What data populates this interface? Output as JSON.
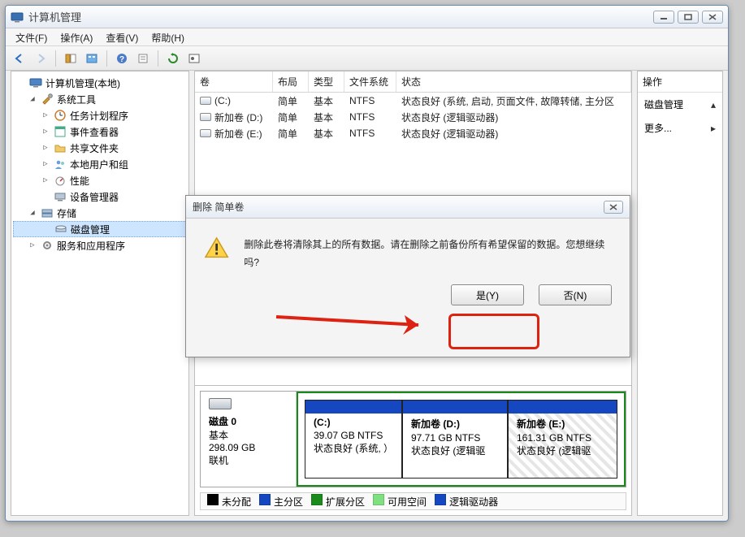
{
  "window": {
    "title": "计算机管理"
  },
  "menu": {
    "file": "文件(F)",
    "action": "操作(A)",
    "view": "查看(V)",
    "help": "帮助(H)"
  },
  "tree": {
    "root": "计算机管理(本地)",
    "systools": "系统工具",
    "sched": "任务计划程序",
    "evt": "事件查看器",
    "share": "共享文件夹",
    "users": "本地用户和组",
    "perf": "性能",
    "devmgr": "设备管理器",
    "storage": "存储",
    "diskmgmt": "磁盘管理",
    "services": "服务和应用程序"
  },
  "volumes": {
    "headers": {
      "vol": "卷",
      "layout": "布局",
      "type": "类型",
      "fs": "文件系统",
      "status": "状态"
    },
    "rows": [
      {
        "name": "(C:)",
        "layout": "简单",
        "type": "基本",
        "fs": "NTFS",
        "status": "状态良好 (系统, 启动, 页面文件, 故障转储, 主分区"
      },
      {
        "name": "新加卷 (D:)",
        "layout": "简单",
        "type": "基本",
        "fs": "NTFS",
        "status": "状态良好 (逻辑驱动器)"
      },
      {
        "name": "新加卷 (E:)",
        "layout": "简单",
        "type": "基本",
        "fs": "NTFS",
        "status": "状态良好 (逻辑驱动器)"
      }
    ]
  },
  "actions": {
    "header": "操作",
    "diskmgmt": "磁盘管理",
    "more": "更多..."
  },
  "disk": {
    "name": "磁盘 0",
    "type": "基本",
    "size": "298.09 GB",
    "state": "联机",
    "parts": [
      {
        "label": "(C:)",
        "sub1": "39.07 GB NTFS",
        "sub2": "状态良好 (系统, ）"
      },
      {
        "label": "新加卷 (D:)",
        "sub1": "97.71 GB NTFS",
        "sub2": "状态良好 (逻辑驱"
      },
      {
        "label": "新加卷 (E:)",
        "sub1": "161.31 GB NTFS",
        "sub2": "状态良好 (逻辑驱"
      }
    ]
  },
  "legend": {
    "unalloc": "未分配",
    "primary": "主分区",
    "ext": "扩展分区",
    "free": "可用空间",
    "logical": "逻辑驱动器",
    "colors": {
      "unalloc": "#000000",
      "primary": "#1547c0",
      "ext": "#1a8a1a",
      "free": "#7ee07e",
      "logical": "#1547c0"
    }
  },
  "dialog": {
    "title": "删除 简单卷",
    "text": "删除此卷将清除其上的所有数据。请在删除之前备份所有希望保留的数据。您想继续吗?",
    "yes": "是(Y)",
    "no": "否(N)"
  }
}
